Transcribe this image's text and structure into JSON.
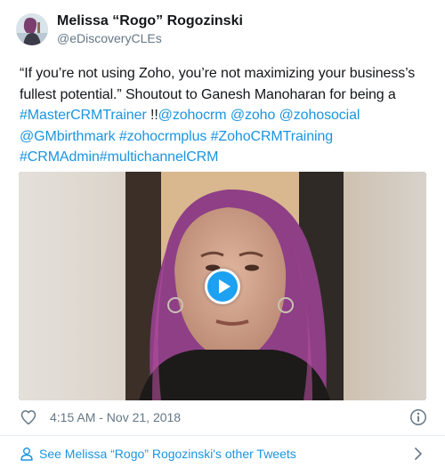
{
  "author": {
    "display_name": "Melissa “Rogo” Rogozinski",
    "handle": "@eDiscoveryCLEs"
  },
  "tweet": {
    "line1": "“If you’re not using Zoho, you’re not maximizing your business’s",
    "line2_text": "fullest potential.”  Shoutout to Ganesh Manoharan for being a",
    "line3_link1": "#MasterCRMTrainer",
    "line3_sep": " !!",
    "line3_link2": "@zohocrm",
    "line3_link3": "@zoho",
    "line3_link4": "@zohosocial",
    "line4_link1": "@GMbirthmark",
    "line4_link2": "#zohocrmplus",
    "line4_link3": "#ZohoCRMTraining",
    "line5_link1": "#CRMAdmin",
    "line5_link2": "#multichannelCRM"
  },
  "meta": {
    "timestamp": "4:15 AM - Nov 21, 2018"
  },
  "footer": {
    "label": "See Melissa “Rogo” Rogozinski's other Tweets"
  },
  "icons": {
    "like": "heart-icon",
    "info": "info-icon",
    "profile": "person-icon",
    "more": "chevron-right-icon",
    "play": "play-icon"
  },
  "colors": {
    "link": "#1b95e0",
    "play_button": "#1da1f2",
    "secondary_text": "#657786"
  }
}
